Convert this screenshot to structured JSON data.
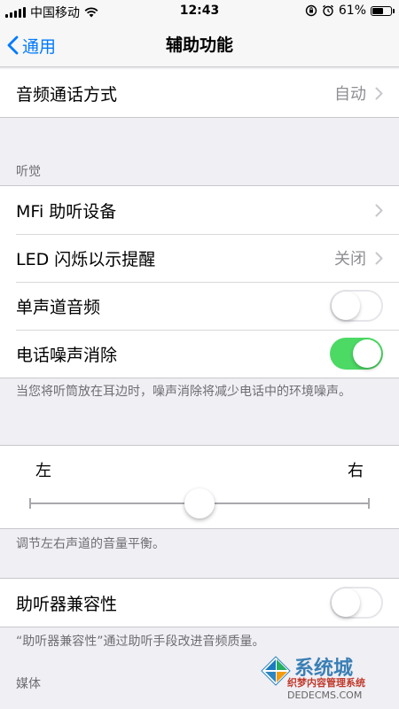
{
  "status_bar": {
    "carrier": "中国移动",
    "time": "12:43",
    "battery_percent": "61%",
    "battery_level": 0.61
  },
  "nav": {
    "back_label": "通用",
    "title": "辅助功能"
  },
  "audio_routing": {
    "label": "音频通话方式",
    "value": "自动"
  },
  "hearing": {
    "header": "听觉",
    "items": [
      {
        "label": "MFi 助听设备",
        "value": ""
      },
      {
        "label": "LED 闪烁以示提醒",
        "value": "关闭"
      },
      {
        "label": "单声道音频",
        "toggle": false
      },
      {
        "label": "电话噪声消除",
        "toggle": true
      }
    ],
    "footer": "当您将听筒放在耳边时，噪声消除将减少电话中的环境噪声。"
  },
  "balance": {
    "left_label": "左",
    "right_label": "右",
    "value": 0.5,
    "footer": "调节左右声道的音量平衡。"
  },
  "hac": {
    "label": "助听器兼容性",
    "toggle": false,
    "footer": "“助听器兼容性”通过助听手段改进音频质量。"
  },
  "media": {
    "header": "媒体"
  },
  "watermark": {
    "title": "系统城",
    "subtitle": "织梦内容管理系统",
    "url": "DEDECMS.COM"
  },
  "colors": {
    "accent": "#007aff",
    "toggle_on": "#4cd964"
  }
}
